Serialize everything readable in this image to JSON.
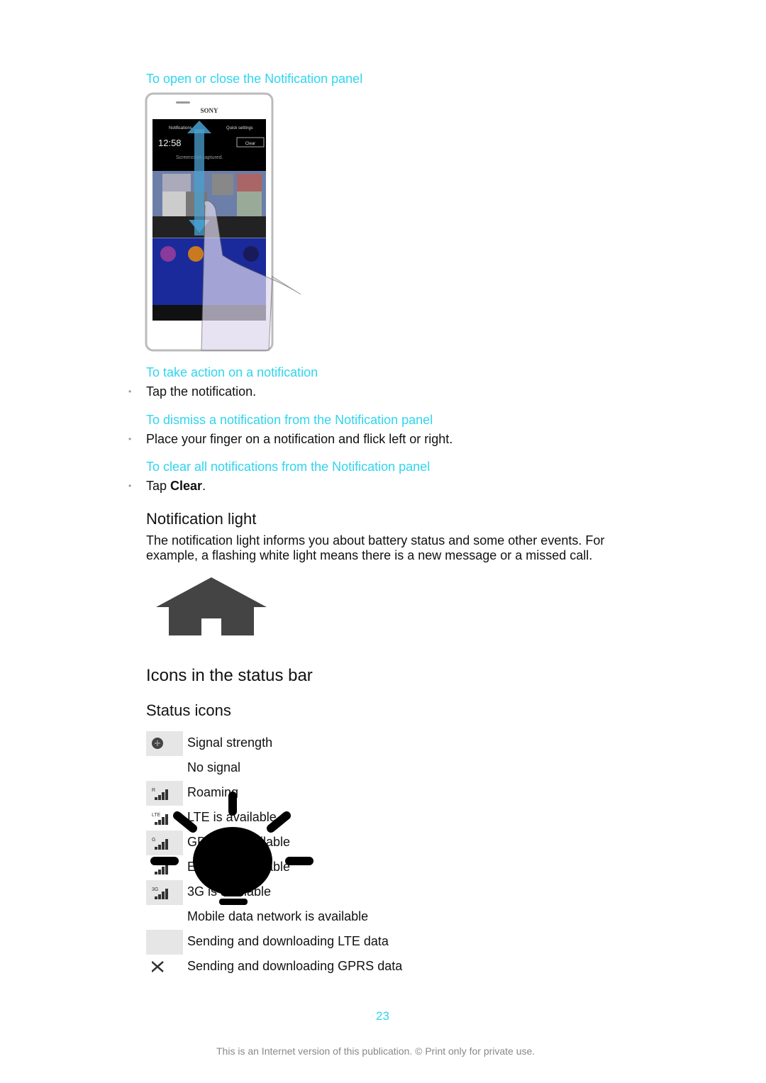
{
  "sections": {
    "open_close_heading": "To open or close the Notification panel",
    "phone_image": {
      "brand": "SONY",
      "tabs": [
        "Notifications",
        "Quick settings"
      ],
      "time": "12:58",
      "clear": "Clear",
      "notification": "Screenshot captured."
    },
    "take_action_heading": "To take action on a notification",
    "take_action_step": "Tap the notification.",
    "dismiss_heading": "To dismiss a notification from the Notification panel",
    "dismiss_step": "Place your finger on a notification and flick left or right.",
    "clear_heading": "To clear all notifications from the Notification panel",
    "clear_step_prefix": "Tap ",
    "clear_step_bold": "Clear",
    "clear_step_suffix": ".",
    "notification_light_title": "Notification light",
    "notification_light_line1": "The notification light informs you about battery status and some other events. For",
    "notification_light_line2": "example, a flashing white light means there is a new message or a missed call.",
    "icons_title": "Icons in the status bar",
    "status_icons_title": "Status icons"
  },
  "status_icons": [
    {
      "label": "Signal strength",
      "icon": "plus-circle-icon",
      "shaded": true
    },
    {
      "label": "No signal",
      "icon": "",
      "shaded": false
    },
    {
      "label": "Roaming",
      "icon": "signal-roaming-icon",
      "badge": "R",
      "shaded": true
    },
    {
      "label": "LTE is available",
      "icon": "signal-lte-icon",
      "badge": "LTE",
      "shaded": false
    },
    {
      "label": "GPRS is available",
      "icon": "signal-gprs-icon",
      "badge": "G",
      "shaded": true
    },
    {
      "label": "EDGE is available",
      "icon": "signal-edge-icon",
      "badge": "",
      "shaded": false
    },
    {
      "label": "3G is available",
      "icon": "signal-3g-icon",
      "badge": "3G",
      "shaded": true
    },
    {
      "label": "Mobile data network is available",
      "icon": "",
      "shaded": false
    },
    {
      "label": "Sending and downloading LTE data",
      "icon": "",
      "shaded": true
    },
    {
      "label": "Sending and downloading GPRS data",
      "icon": "close-x-icon",
      "shaded": false
    }
  ],
  "footer": {
    "page_number": "23",
    "notice": "This is an Internet version of this publication. © Print only for private use."
  },
  "colors": {
    "heading_accent": "#2fd5ee",
    "icon_dark": "#444444"
  }
}
